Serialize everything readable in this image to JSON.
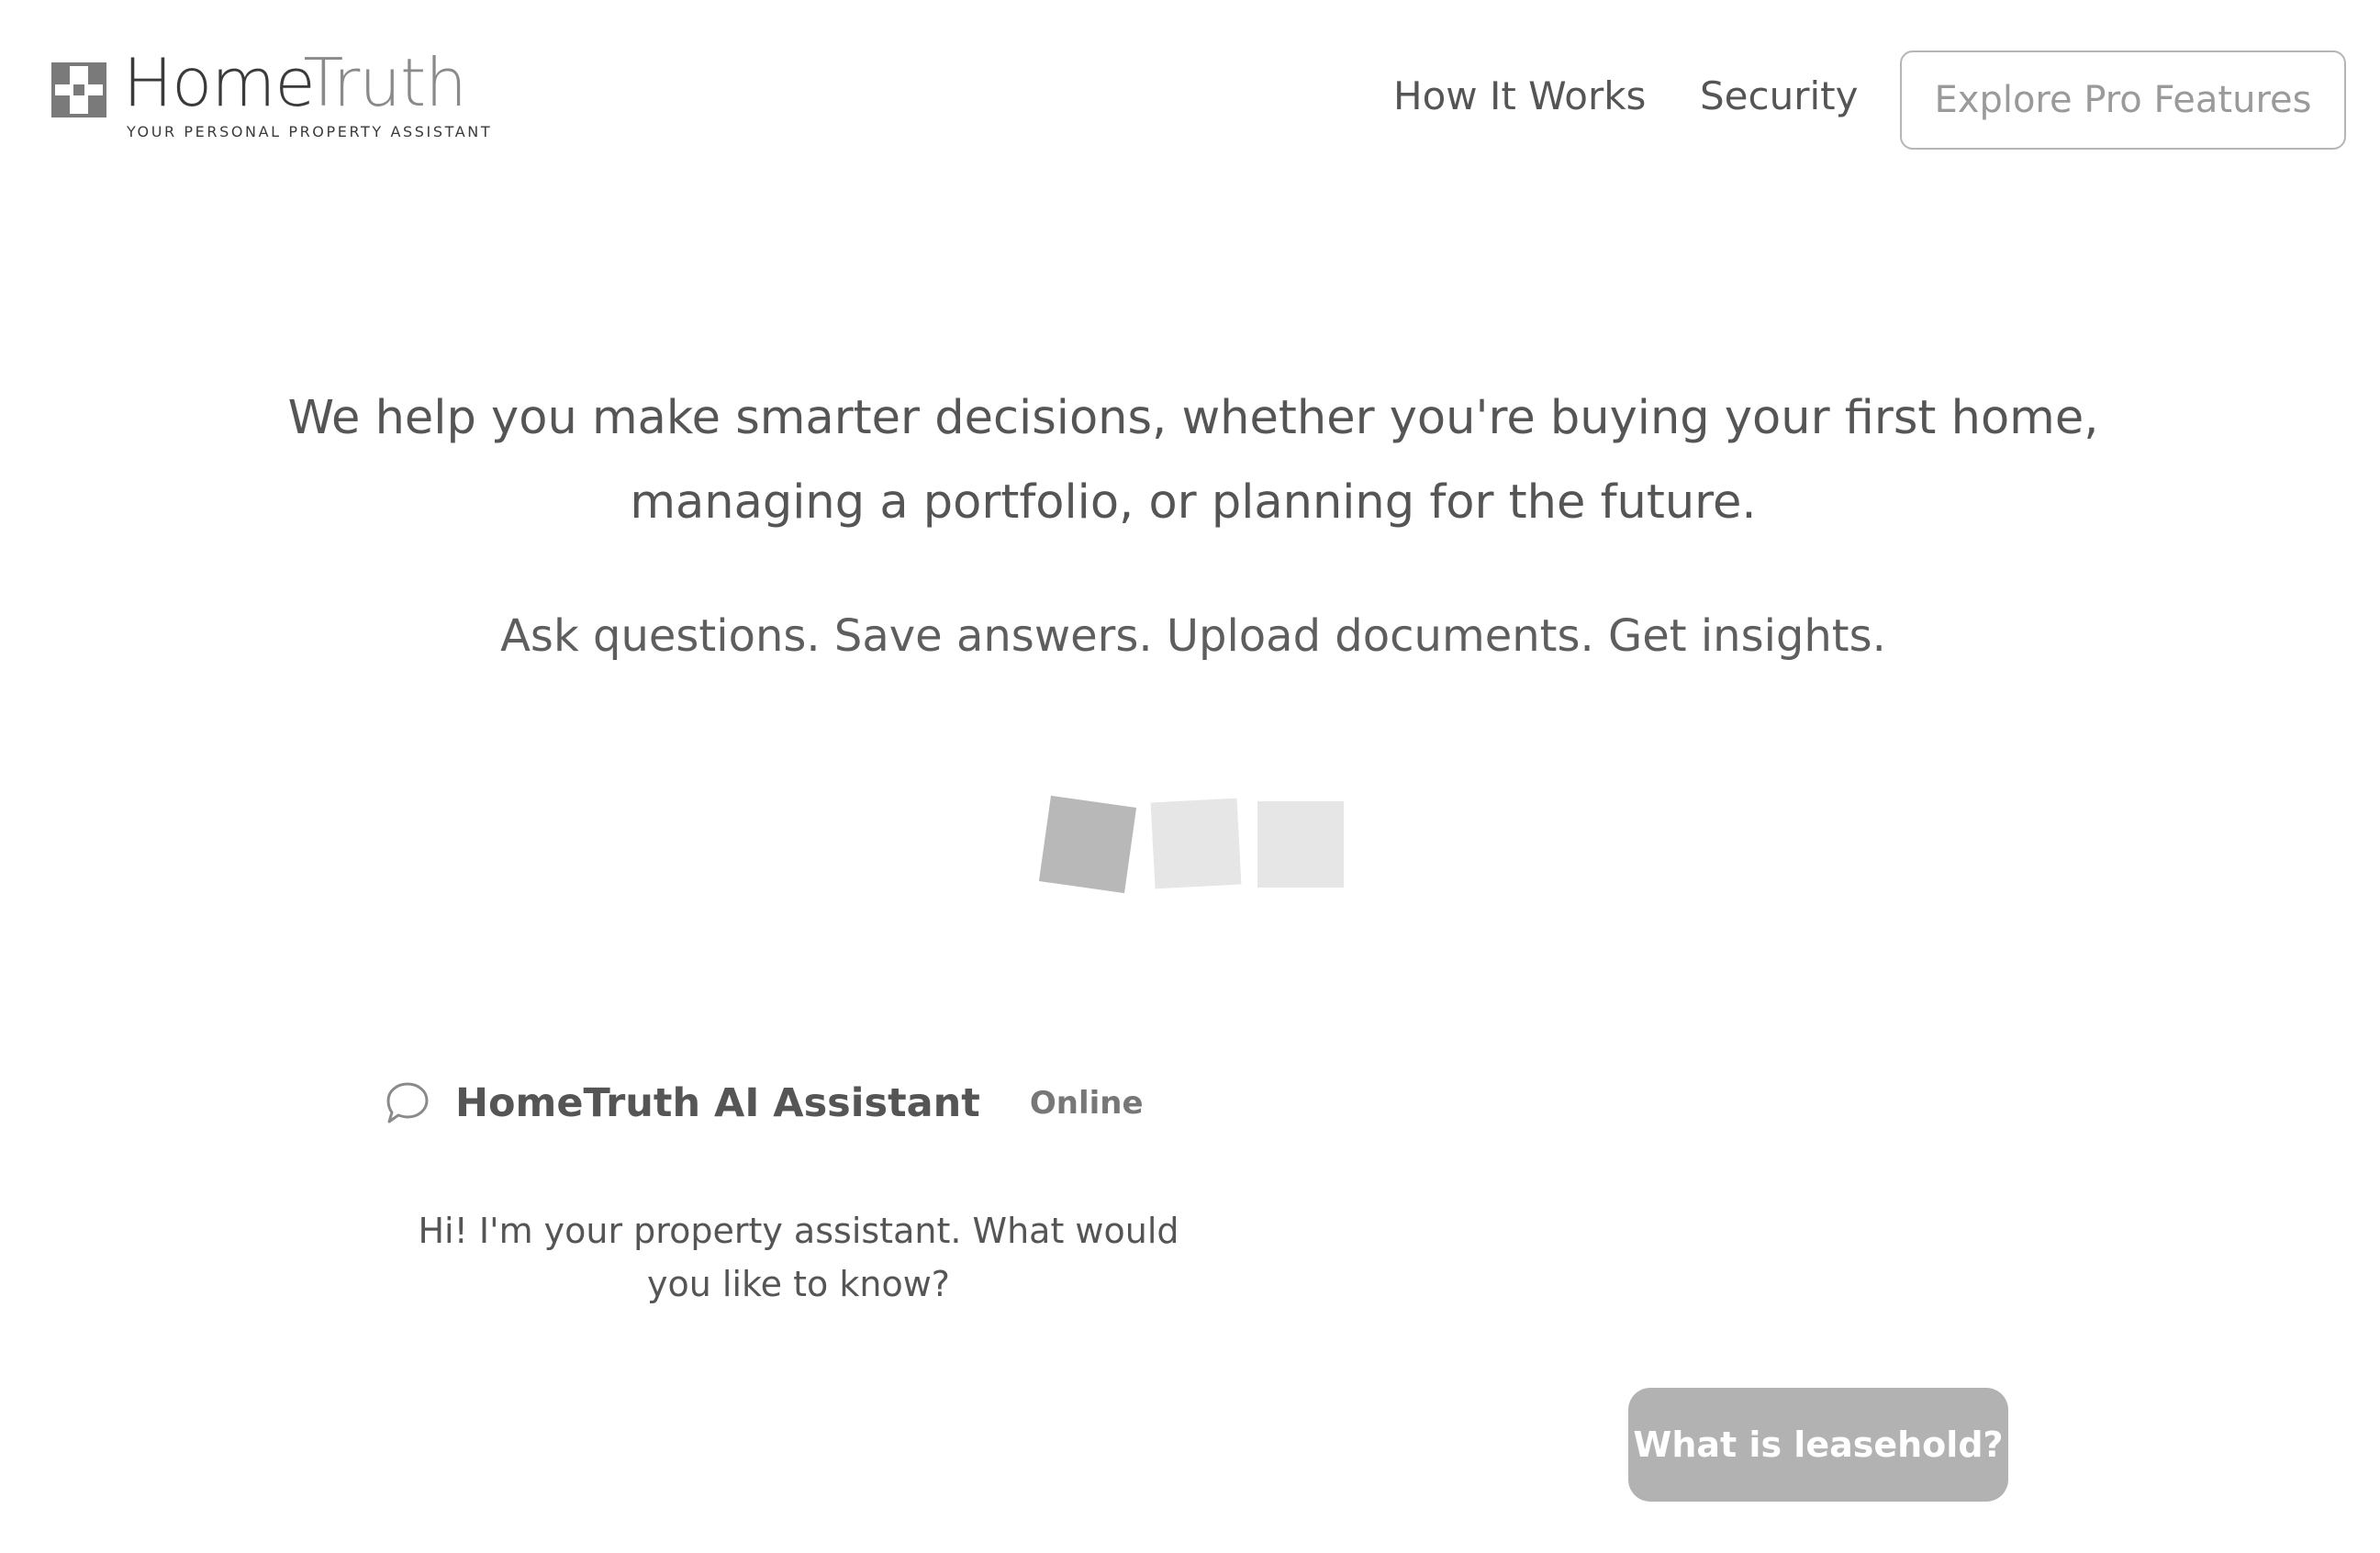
{
  "header": {
    "logo": {
      "brand_part1": "Home",
      "brand_part2": "Truth",
      "tagline": "YOUR PERSONAL PROPERTY ASSISTANT",
      "icon": "house-grid-logo-icon"
    },
    "nav": {
      "how_it_works": "How It Works",
      "security": "Security"
    },
    "cta_label": "Explore Pro Features"
  },
  "hero": {
    "headline": "We help you make smarter decisions, whether you're buying your first home, managing a portfolio, or planning for the future.",
    "subline": "Ask questions. Save answers. Upload documents. Get insights."
  },
  "loader": {
    "squares": 3,
    "active_index": 0
  },
  "chat": {
    "icon": "speech-bubble-icon",
    "title": "HomeTruth AI Assistant",
    "status": "Online",
    "messages": [
      {
        "role": "assistant",
        "text": "Hi! I'm your property assistant. What would you like to know?"
      },
      {
        "role": "user",
        "text": "What is leasehold?"
      }
    ]
  },
  "colors": {
    "text_primary": "#555555",
    "loader_active": "#b8b8b8",
    "loader_inactive": "#e6e6e6",
    "user_bubble": "#b2b2b2",
    "button_border": "#b5b5b5"
  }
}
